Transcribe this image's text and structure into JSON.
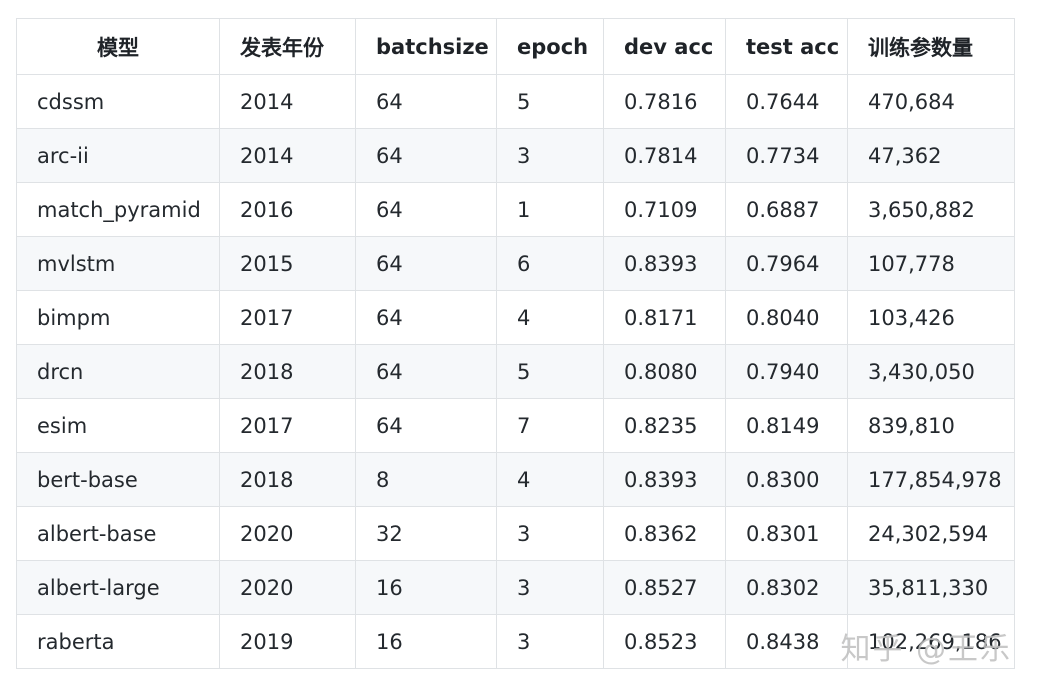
{
  "table": {
    "headers": [
      "模型",
      "发表年份",
      "batchsize",
      "epoch",
      "dev acc",
      "test acc",
      "训练参数量"
    ],
    "rows": [
      [
        "cdssm",
        "2014",
        "64",
        "5",
        "0.7816",
        "0.7644",
        "470,684"
      ],
      [
        "arc-ii",
        "2014",
        "64",
        "3",
        "0.7814",
        "0.7734",
        "47,362"
      ],
      [
        "match_pyramid",
        "2016",
        "64",
        "1",
        "0.7109",
        "0.6887",
        "3,650,882"
      ],
      [
        "mvlstm",
        "2015",
        "64",
        "6",
        "0.8393",
        "0.7964",
        "107,778"
      ],
      [
        "bimpm",
        "2017",
        "64",
        "4",
        "0.8171",
        "0.8040",
        "103,426"
      ],
      [
        "drcn",
        "2018",
        "64",
        "5",
        "0.8080",
        "0.7940",
        "3,430,050"
      ],
      [
        "esim",
        "2017",
        "64",
        "7",
        "0.8235",
        "0.8149",
        "839,810"
      ],
      [
        "bert-base",
        "2018",
        "8",
        "4",
        "0.8393",
        "0.8300",
        "177,854,978"
      ],
      [
        "albert-base",
        "2020",
        "32",
        "3",
        "0.8362",
        "0.8301",
        "24,302,594"
      ],
      [
        "albert-large",
        "2020",
        "16",
        "3",
        "0.8527",
        "0.8302",
        "35,811,330"
      ],
      [
        "raberta",
        "2019",
        "16",
        "3",
        "0.8523",
        "0.8438",
        "102,269,186"
      ]
    ]
  },
  "watermark": "知乎 @王乐"
}
